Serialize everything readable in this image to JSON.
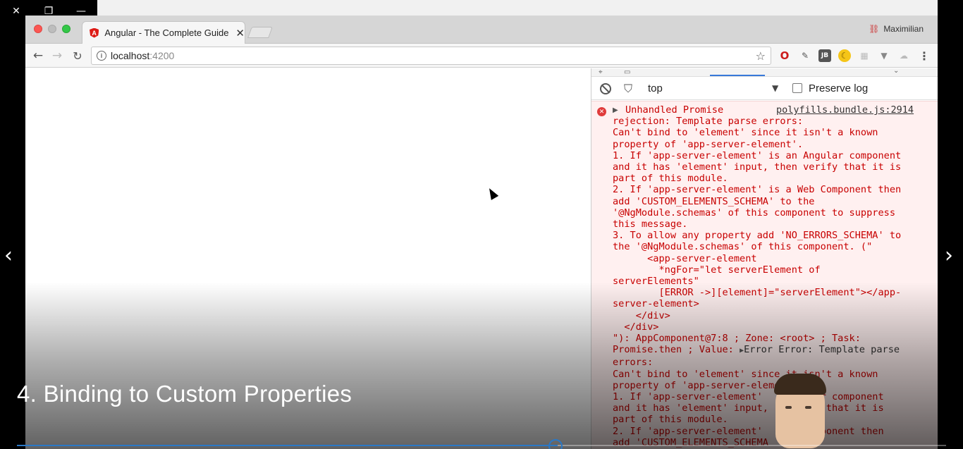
{
  "window_controls": {
    "close": "✕",
    "restore": "❐",
    "minimize": "—"
  },
  "browser": {
    "tab": {
      "title": "Angular - The Complete Guide",
      "logo_letter": "A",
      "close_glyph": "✕"
    },
    "profile_name": "Maximilian",
    "url": {
      "host": "localhost",
      "port": ":4200"
    }
  },
  "devtools": {
    "context": "top",
    "preserve_log_label": "Preserve log",
    "error": {
      "source": "polyfills.bundle.js:2914",
      "first_line": "Unhandled Promise",
      "lines_a": [
        "rejection: Template parse errors:",
        "Can't bind to 'element' since it isn't a known",
        "property of 'app-server-element'.",
        "1. If 'app-server-element' is an Angular component",
        "and it has 'element' input, then verify that it is",
        "part of this module.",
        "2. If 'app-server-element' is a Web Component then",
        "add 'CUSTOM_ELEMENTS_SCHEMA' to the",
        "'@NgModule.schemas' of this component to suppress",
        "this message.",
        "3. To allow any property add 'NO_ERRORS_SCHEMA' to",
        "the '@NgModule.schemas' of this component. (\"",
        "      <app-server-element",
        "        *ngFor=\"let serverElement of",
        "serverElements\"",
        "        [ERROR ->][element]=\"serverElement\"></app-",
        "server-element>",
        "    </div>",
        "  </div>",
        "\"): AppComponent@7:8 ; Zone: <root> ; Task:"
      ],
      "value_prefix": "Promise.then ; Value: ",
      "value_triangle": "▶",
      "value_error": "Error Error: Template parse",
      "lines_b": [
        "errors:",
        "Can't bind to 'element' since it isn't a known",
        "property of 'app-server-eleme",
        "1. If 'app-server-element'       ular component",
        "and it has 'element' input,       fy that it is",
        "part of this module.",
        "2. If 'app-server-element'       Component then",
        "add 'CUSTOM_ELEMENTS_SCHEMA"
      ]
    }
  },
  "video": {
    "title": "4. Binding to Custom Properties",
    "progress": 0.582,
    "prev_glyph": "‹",
    "next_glyph": "›"
  },
  "icons": {
    "back": "←",
    "forward": "→",
    "reload": "↻",
    "star": "☆",
    "menu": "⋮",
    "filter": "⛉",
    "dropdown": "▼",
    "error": "✕",
    "expander": "▶"
  },
  "colors": {
    "error_text": "#c80000",
    "error_bg": "#fff0f0",
    "progress": "#2b78c5"
  }
}
